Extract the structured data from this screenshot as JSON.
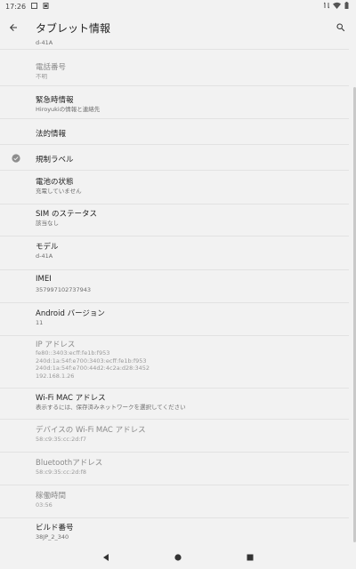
{
  "status": {
    "time": "17:26",
    "battery_icon": "battery-icon"
  },
  "appbar": {
    "title": "タブレット情報"
  },
  "list": {
    "top_partial_sub": "d-41A",
    "items": [
      {
        "title": "電話番号",
        "sub": "不明"
      },
      {
        "title": "緊急時情報",
        "sub": "Hiroyukiの情報と連絡先"
      },
      {
        "title": "法的情報"
      },
      {
        "title": "規制ラベル"
      },
      {
        "title": "電池の状態",
        "sub": "充電していません"
      },
      {
        "title": "SIM のステータス",
        "sub": "該当なし"
      },
      {
        "title": "モデル",
        "sub": "d-41A"
      },
      {
        "title": "IMEI",
        "sub": "357997102737943"
      },
      {
        "title": "Android バージョン",
        "sub": "11"
      },
      {
        "title": "IP アドレス",
        "sub_lines": [
          "fe80::3403:ecff:fe1b:f953",
          "240d:1a:54f:e700:3403:ecff:fe1b:f953",
          "240d:1a:54f:e700:44d2:4c2a:d28:3452",
          "192.168.1.26"
        ]
      },
      {
        "title": "Wi-Fi MAC アドレス",
        "sub": "表示するには、保存済みネットワークを選択してください"
      },
      {
        "title": "デバイスの Wi-Fi MAC アドレス",
        "sub": "58:c9:35:cc:2d:f7"
      },
      {
        "title": "Bluetoothアドレス",
        "sub": "58:c9:35:cc:2d:f8"
      },
      {
        "title": "稼働時間",
        "sub": "03:56"
      },
      {
        "title": "ビルド番号",
        "sub": "38JP_2_340"
      }
    ]
  }
}
